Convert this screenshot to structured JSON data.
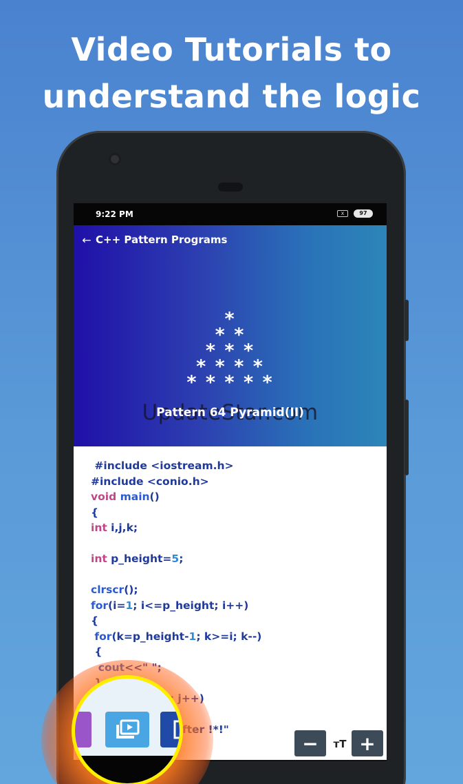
{
  "headline": {
    "line1": "Video Tutorials to",
    "line2": "understand the logic"
  },
  "statusbar": {
    "time": "9:22 PM",
    "sim_icon": "x",
    "battery": "97"
  },
  "appbar": {
    "back_icon": "←",
    "title": "C++ Pattern Programs"
  },
  "hero": {
    "pyramid_rows": [
      "*",
      "* *",
      "* * *",
      "* * * *",
      "* * * * *"
    ],
    "watermark": "UpdateStar.com",
    "pattern_title": "Pattern 64 Pyramid(II)"
  },
  "code": {
    "lines": [
      " #include <iostream.h>",
      "#include <conio.h>",
      "void main()",
      "{",
      "int i,j,k;",
      "",
      "int p_height=5;",
      "",
      "clrscr();",
      "for(i=1; i<=p_height; i++)",
      "{",
      " for(k=p_height-1; k>=i; k--)",
      " {",
      "  cout<<\" \";",
      " }",
      " for(j=1; j<=i; j++)",
      "",
      "  cout<<\"  ...  after !*!\""
    ]
  },
  "controls": {
    "minus_label": "−",
    "font_size_icon": "тT",
    "plus_label": "+"
  },
  "highlight_buttons": {
    "share_icon": "share-icon",
    "video_icon": "video-library-icon",
    "code_icon": "code-file-icon"
  },
  "colors": {
    "background_top": "#4a82cf",
    "hero_left": "#2010a8",
    "hero_right": "#2c86b8",
    "keyword": "#c0468a",
    "code_text": "#203a9a",
    "control_bg": "#3d4a58",
    "highlight_ring": "#ffee00"
  }
}
